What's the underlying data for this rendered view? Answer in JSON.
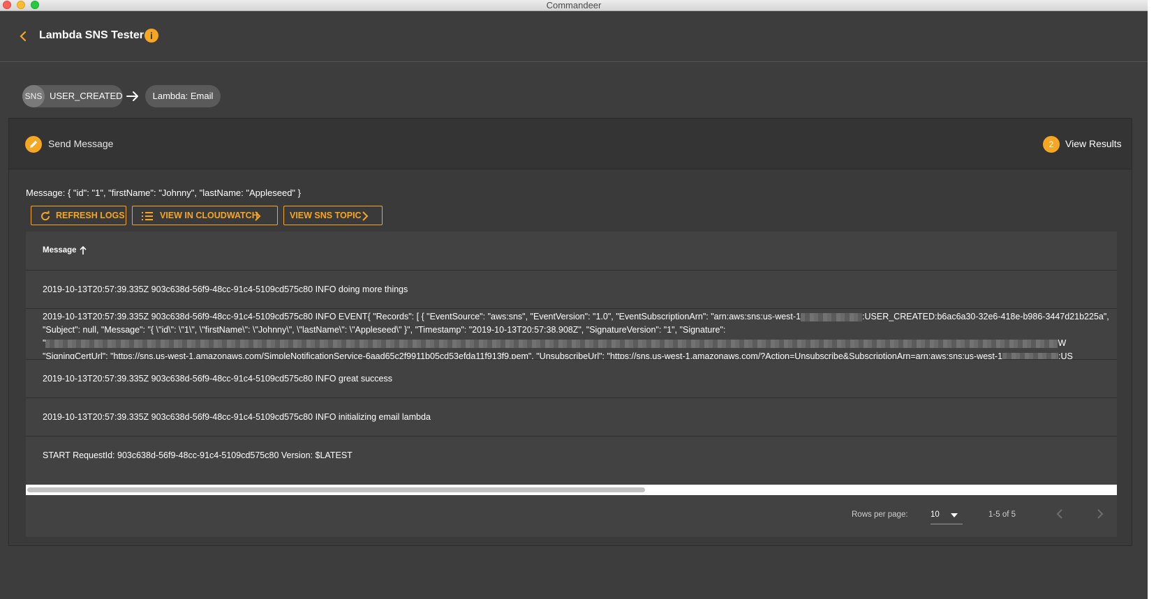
{
  "window": {
    "title": "Commandeer"
  },
  "header": {
    "title": "Lambda SNS Tester",
    "info_icon": "i"
  },
  "flow": {
    "source_badge": "SNS",
    "source_label": "USER_CREATED",
    "target_label": "Lambda: Email"
  },
  "stepper": {
    "step1_label": "Send Message",
    "step2_number": "2",
    "step2_label": "View Results"
  },
  "message_text": "Message: { \"id\": \"1\", \"firstName\": \"Johnny\", \"lastName: \"Appleseed\" }",
  "buttons": {
    "refresh_logs": "REFRESH LOGS",
    "view_cloudwatch": "VIEW IN CLOUDWATCH",
    "view_sns_topic": "VIEW SNS TOPIC"
  },
  "table": {
    "column_header": "Message",
    "rows": [
      "2019-10-13T20:57:39.335Z 903c638d-56f9-48cc-91c4-5109cd575c80 INFO doing more things",
      {
        "line1_a": "2019-10-13T20:57:39.335Z 903c638d-56f9-48cc-91c4-5109cd575c80 INFO EVENT{ \"Records\": [ { \"EventSource\": \"aws:sns\", \"EventVersion\": \"1.0\", \"EventSubscriptionArn\": \"arn:aws:sns:us-west-1",
        "line1_b": ":USER_CREATED:b6ac6a30-32e6-418e-b986-3447d21b225a\",",
        "line2": "\"Subject\": null, \"Message\": \"{ \\\"id\\\": \\\"1\\\", \\\"firstName\\\": \\\"Johnny\\\", \\\"lastName\\\": \\\"Appleseed\\\" }\", \"Timestamp\": \"2019-10-13T20:57:38.908Z\", \"SignatureVersion\": \"1\", \"Signature\":",
        "line3_a": "\"",
        "line3_b": "W",
        "line4": "\"SigningCertUrl\": \"https://sns.us-west-1.amazonaws.com/SimpleNotificationService-6aad65c2f9911b05cd53efda11f913f9.pem\", \"UnsubscribeUrl\": \"https://sns.us-west-1.amazonaws.com/?Action=Unsubscribe&SubscriptionArn=arn:aws:sns:us-west-1",
        "line4_b": ":US"
      },
      "2019-10-13T20:57:39.335Z 903c638d-56f9-48cc-91c4-5109cd575c80 INFO great success",
      "2019-10-13T20:57:39.335Z 903c638d-56f9-48cc-91c4-5109cd575c80 INFO initializing email lambda",
      "START RequestId: 903c638d-56f9-48cc-91c4-5109cd575c80 Version: $LATEST"
    ]
  },
  "pagination": {
    "rows_per_page_label": "Rows per page:",
    "rows_per_page_value": "10",
    "range": "1-5 of 5"
  },
  "colors": {
    "accent": "#f5a623",
    "background": "#3d3d3d",
    "table": "#424242"
  },
  "icons": [
    "back-chevron-icon",
    "info-icon",
    "arrow-right-icon",
    "edit-pencil-icon",
    "refresh-icon",
    "list-icon",
    "chevron-right-icon",
    "sort-up-icon",
    "caret-down-icon",
    "chevron-left-icon"
  ]
}
